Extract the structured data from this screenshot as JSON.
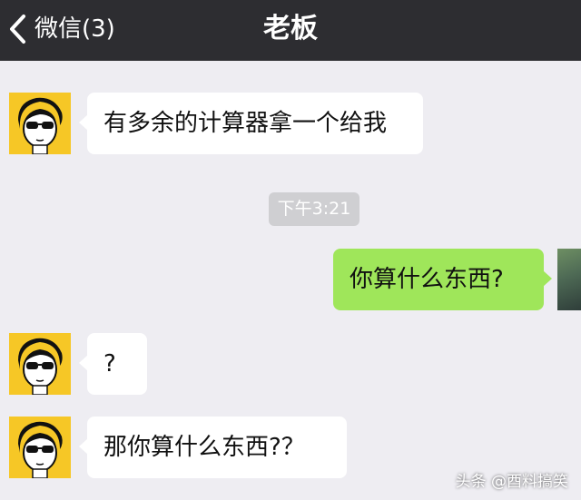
{
  "header": {
    "back_label": "微信(3)",
    "title": "老板"
  },
  "messages": [
    {
      "side": "in",
      "text": "有多余的计算器拿一个给我"
    },
    {
      "side": "out",
      "text": "你算什么东西?"
    },
    {
      "side": "in",
      "text": "?"
    },
    {
      "side": "in",
      "text": "那你算什么东西?？"
    }
  ],
  "timestamp": "下午3:21",
  "watermark": "头条 @酉料搞笑",
  "colors": {
    "topbar": "#2d2d31",
    "background": "#eeedf2",
    "outgoing_bubble": "#9fe65a",
    "incoming_bubble": "#ffffff",
    "avatar_bg": "#f6c726"
  }
}
